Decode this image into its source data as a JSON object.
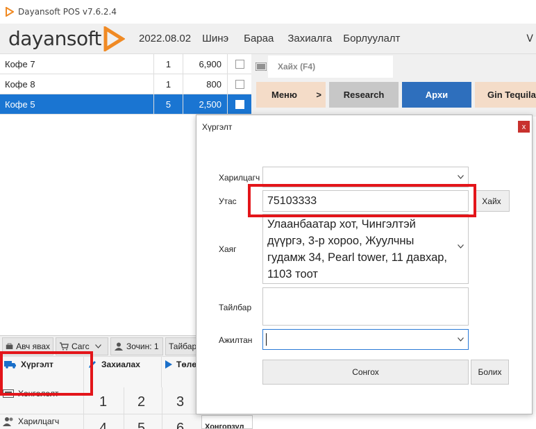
{
  "window": {
    "title": "Dayansoft POS v7.6.2.4"
  },
  "brand": {
    "logo_text": "dayansoft",
    "accent": "#f08a24"
  },
  "nav": {
    "date": "2022.08.02",
    "items": [
      "Шинэ",
      "Бараа",
      "Захиалга",
      "Борлуулалт"
    ],
    "more": "V"
  },
  "order_items": [
    {
      "name": "Кофе 7",
      "qty": "1",
      "price": "6,900",
      "selected": false
    },
    {
      "name": "Кофе 8",
      "qty": "1",
      "price": "800",
      "selected": false
    },
    {
      "name": "Кофе 5",
      "qty": "5",
      "price": "2,500",
      "selected": true
    }
  ],
  "search": {
    "placeholder": "Хайх (F4)"
  },
  "categories": {
    "menu": "Меню",
    "menu_arrow": ">",
    "research": "Research",
    "arkhi": "Архи",
    "gin": "Gin Tequila"
  },
  "toolbar": {
    "takeaway": "Авч явах",
    "cart": "Сагс",
    "guests": "Зочин: 1",
    "table": "Тайбар"
  },
  "actions": {
    "delivery": "Хүргэлт",
    "order": "Захиалах",
    "pay": "Төлө"
  },
  "side_rows": {
    "discount": "Хөнгөлөлт",
    "customer": "Харилцагч"
  },
  "numpad": [
    "1",
    "2",
    "3",
    "4",
    "5",
    "6"
  ],
  "bottom_tab": "Хонгорзул",
  "modal": {
    "title": "Хүргэлт",
    "close": "x",
    "labels": {
      "customer": "Харилцагч",
      "phone": "Утас",
      "address": "Хаяг",
      "note": "Тайлбар",
      "employee": "Ажилтан"
    },
    "customer_value": "",
    "phone_value": "75103333",
    "address_value": "Улаанбаатар хот, Чингэлтэй дүүргэ, 3-р хороо, Жуулчны гудамж 34, Pearl tower, 11 давхар, 1103 тоот",
    "note_value": "",
    "employee_value": "",
    "search_button": "Хайх",
    "select_button": "Сонгох",
    "cancel_button": "Болих"
  },
  "colors": {
    "selected_row": "#1a75d2",
    "highlight": "#e3151a",
    "close_button": "#c8312d"
  }
}
